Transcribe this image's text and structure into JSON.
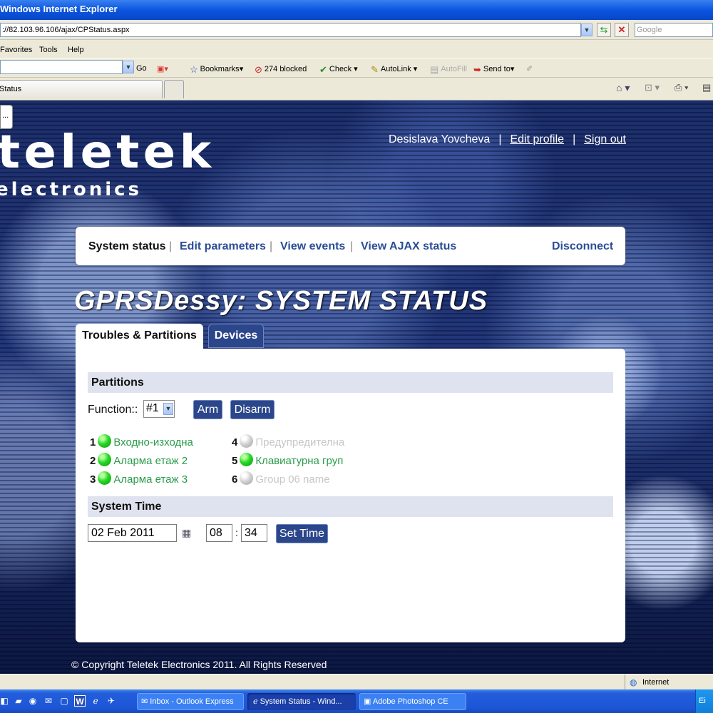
{
  "browser": {
    "title": "Windows Internet Explorer",
    "address": "://82.103.96.106/ajax/CPStatus.aspx",
    "search_placeholder": "Google",
    "menu": [
      "Favorites",
      "Tools",
      "Help"
    ],
    "toolbar": {
      "go": "Go",
      "bookmarks": "Bookmarks",
      "blocked": "274 blocked",
      "check": "Check",
      "autolink": "AutoLink",
      "autofill": "AutoFill",
      "sendto": "Send to"
    },
    "tab_title": "Status",
    "status_zone": "Internet",
    "status_right": "Ei"
  },
  "site": {
    "small_box": "...",
    "logo_top": "teletek",
    "logo_bottom": "electronics",
    "user_name": "Desislava Yovcheva",
    "edit_profile": "Edit profile",
    "sign_out": "Sign out",
    "separator": "|",
    "nav": {
      "system_status": "System status",
      "edit_parameters": "Edit parameters",
      "view_events": "View events",
      "view_ajax_status": "View AJAX status",
      "disconnect": "Disconnect"
    },
    "page_title": "GPRSDessy: SYSTEM STATUS",
    "tabs": {
      "troubles": "Troubles & Partitions",
      "devices": "Devices"
    },
    "partitions": {
      "heading": "Partitions",
      "function_label": "Function::",
      "function_value": "#1",
      "arm": "Arm",
      "disarm": "Disarm",
      "items": [
        {
          "num": "1",
          "name": "Входно-изходна",
          "active": true
        },
        {
          "num": "2",
          "name": "Аларма етаж 2",
          "active": true
        },
        {
          "num": "3",
          "name": "Аларма етаж 3",
          "active": true
        },
        {
          "num": "4",
          "name": "Предупредителна",
          "active": false
        },
        {
          "num": "5",
          "name": "Клавиатурна груп",
          "active": true
        },
        {
          "num": "6",
          "name": "Group 06 name",
          "active": false
        }
      ]
    },
    "system_time": {
      "heading": "System Time",
      "date": "02 Feb 2011",
      "hour": "08",
      "colon": ":",
      "minute": "34",
      "set_time": "Set Time"
    },
    "copyright": "© Copyright Teletek Electronics 2011. All Rights Reserved"
  },
  "taskbar": {
    "items": [
      "Inbox - Outlook Express",
      "System Status - Wind...",
      "Adobe Photoshop CE"
    ]
  },
  "colors": {
    "link_blue": "#2b4d95",
    "button_blue": "#2b468a",
    "led_green": "#28d828",
    "led_off": "#cfcfcf",
    "text_green": "#2a9c4a"
  }
}
